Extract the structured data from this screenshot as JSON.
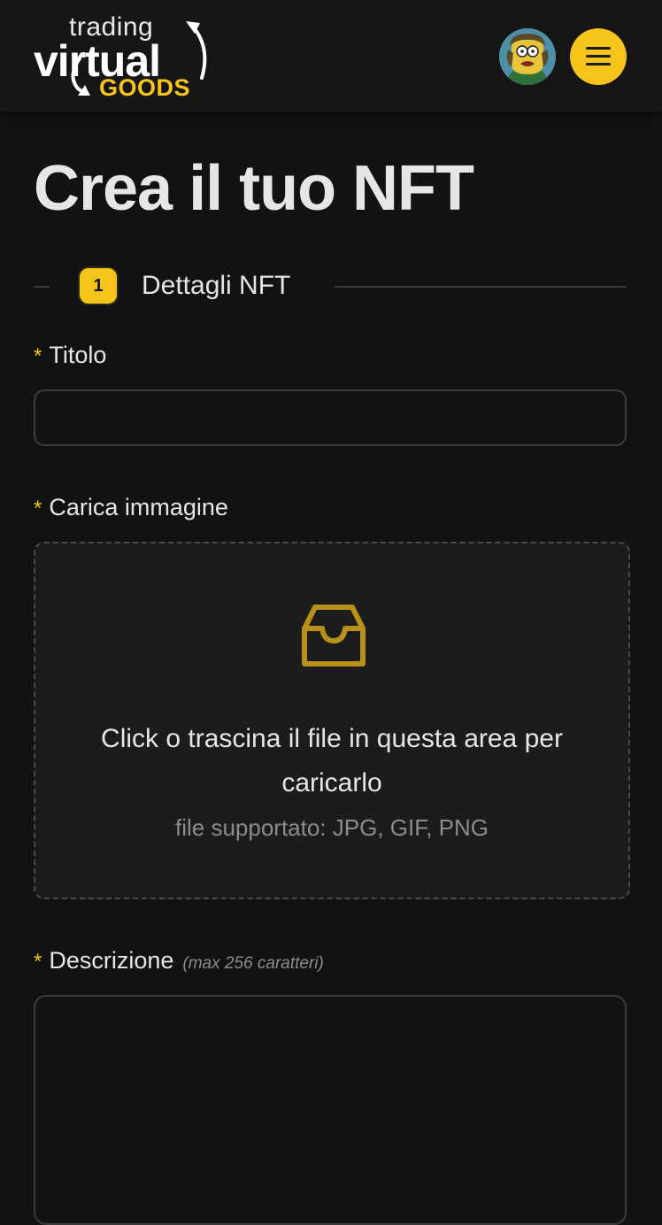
{
  "brand": {
    "logo_top": "trading",
    "logo_main": "virtual",
    "logo_bottom": "GOODS",
    "accent_color": "#f5c51c"
  },
  "header": {
    "avatar_icon": "user-avatar-cartoon",
    "menu_icon": "hamburger-icon"
  },
  "page": {
    "title": "Crea il tuo NFT"
  },
  "stepper": {
    "step_number": "1",
    "step_label": "Dettagli NFT"
  },
  "form": {
    "required_marker": "*",
    "title_field": {
      "label": "Titolo",
      "value": "",
      "placeholder": ""
    },
    "image_field": {
      "label": "Carica immagine",
      "icon": "inbox-icon",
      "dropzone_text": "Click o trascina il file in questa area per caricarlo",
      "supported_formats": "file supportato: JPG, GIF, PNG"
    },
    "description_field": {
      "label": "Descrizione",
      "hint": "(max 256 caratteri)",
      "value": ""
    }
  }
}
